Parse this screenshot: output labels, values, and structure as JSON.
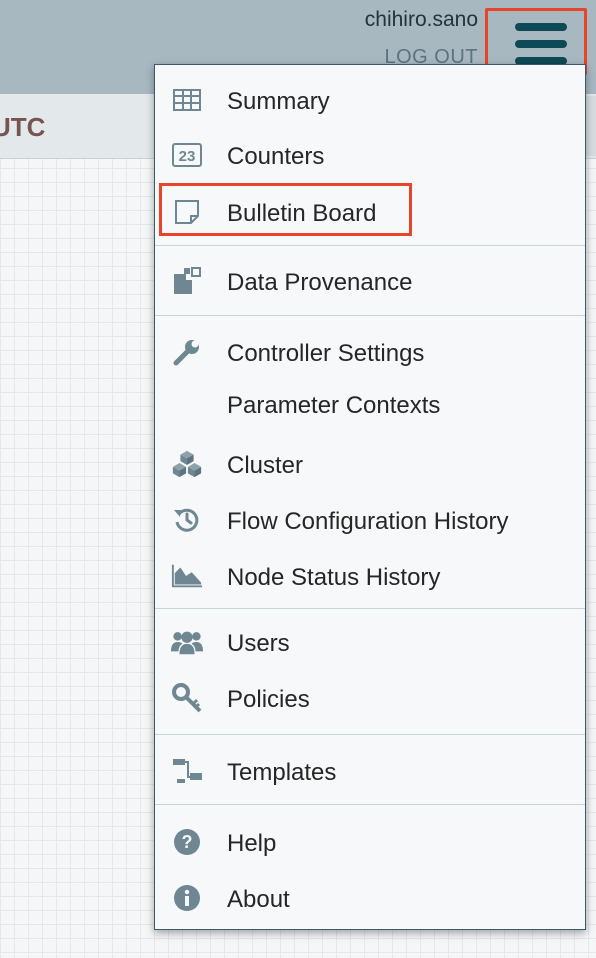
{
  "header": {
    "username": "chihiro.sano",
    "logout_label": "LOG OUT",
    "timezone": "UTC",
    "menu_button_icon": "hamburger-icon"
  },
  "menu": {
    "items": [
      {
        "label": "Summary",
        "icon": "table-icon"
      },
      {
        "label": "Counters",
        "icon": "counter-icon"
      },
      {
        "label": "Bulletin Board",
        "icon": "sticky-note-icon"
      },
      {
        "label": "Data Provenance",
        "icon": "provenance-icon"
      },
      {
        "label": "Controller Settings",
        "icon": "wrench-icon"
      },
      {
        "label": "Parameter Contexts",
        "icon": ""
      },
      {
        "label": "Cluster",
        "icon": "cubes-icon"
      },
      {
        "label": "Flow Configuration History",
        "icon": "history-icon"
      },
      {
        "label": "Node Status History",
        "icon": "area-chart-icon"
      },
      {
        "label": "Users",
        "icon": "users-icon"
      },
      {
        "label": "Policies",
        "icon": "key-icon"
      },
      {
        "label": "Templates",
        "icon": "templates-icon"
      },
      {
        "label": "Help",
        "icon": "question-circle-icon"
      },
      {
        "label": "About",
        "icon": "info-circle-icon"
      }
    ]
  },
  "colors": {
    "topbar": "#a8b8c1",
    "icon": "#6f8793",
    "highlight_border": "#e8432b",
    "hamburger": "#0d4a55"
  }
}
